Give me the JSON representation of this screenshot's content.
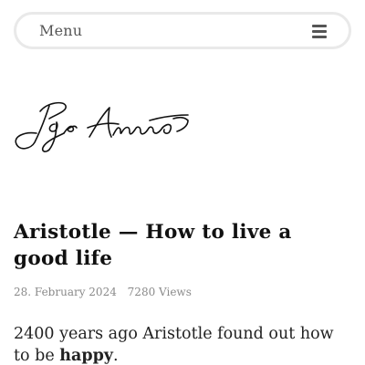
{
  "header": {
    "menu_label": "Menu",
    "menu_icon": "hamburger-icon"
  },
  "logo": {
    "type": "handwritten-signature",
    "text": "Igor Arnold"
  },
  "article": {
    "title": "Aristotle — How to live a good life",
    "date": "28. February 2024",
    "views": "7280 Views",
    "intro_before": "2400 years ago Aristotle found out how to be ",
    "intro_emphasis": "happy",
    "intro_after": "."
  }
}
